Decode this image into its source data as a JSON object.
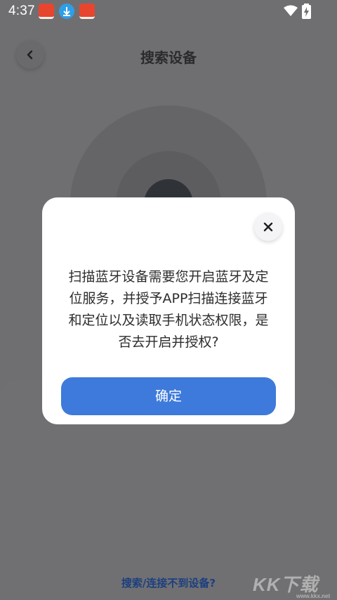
{
  "status_bar": {
    "time": "4:37"
  },
  "header": {
    "title": "搜索设备"
  },
  "footer": {
    "help_link": "搜索/连接不到设备?"
  },
  "dialog": {
    "message_lines": [
      "扫描蓝牙设备需要您开启蓝牙及定",
      "位服务，并授予APP扫描连接蓝牙",
      "和定位以及读取手机状态权限，是",
      "否去开启并授权?"
    ],
    "confirm_label": "确定"
  },
  "watermark": "KK下载",
  "icons": {
    "back": "chevron-left-icon",
    "close": "close-icon",
    "wifi": "wifi-icon",
    "battery": "battery-charging-icon"
  },
  "colors": {
    "accent": "#3d7adb",
    "overlay": "#6f6f71",
    "link": "#1c3f7f"
  }
}
